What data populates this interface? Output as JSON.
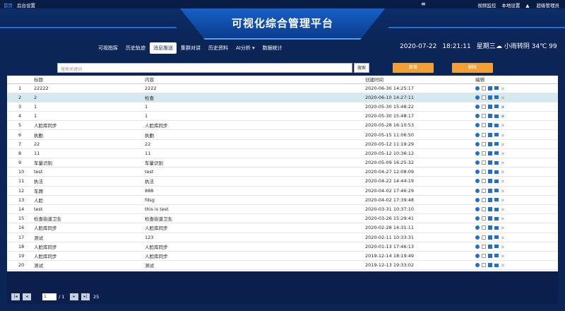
{
  "topbar": {
    "home": "首页",
    "settings": "后台设置",
    "menu": "≡",
    "video": "视频监控",
    "local": "本地设置",
    "user": "超级管理员"
  },
  "title": "可视化综合管理平台",
  "nav": [
    "可视指挥",
    "历史轨迹",
    "消息推送",
    "集群对讲",
    "历史资料",
    "AI分析 ▾",
    "数据统计"
  ],
  "date": "2020-07-22",
  "time": "18:21:11",
  "weekday": "星期三",
  "weather": "小雨转阴",
  "temp": "34℃ 99",
  "search": {
    "placeholder": "搜索关键词",
    "button": "搜索"
  },
  "add_btn": "新增",
  "delete_btn": "删除",
  "table": {
    "headers": [
      "",
      "标题",
      "内容",
      "创建时间",
      "编辑"
    ],
    "rows": [
      [
        "1",
        "22222",
        "2222",
        "2020-06-30 14:25:17"
      ],
      [
        "2",
        "2",
        "检查",
        "2020-06-10 14:27:11"
      ],
      [
        "3",
        "1",
        "1",
        "2020-05-30 15:48:22"
      ],
      [
        "4",
        "1",
        "1",
        "2020-05-30 15:48:17"
      ],
      [
        "5",
        "人脸库同步",
        "人脸库同步",
        "2020-05-28 16:10:53"
      ],
      [
        "6",
        "执勤",
        "执勤",
        "2020-05-15 11:06:50"
      ],
      [
        "7",
        "22",
        "22",
        "2020-05-12 11:19:29"
      ],
      [
        "8",
        "11",
        "11",
        "2020-05-12 10:36:12"
      ],
      [
        "9",
        "车量识别",
        "车量识别",
        "2020-05-09 16:25:32"
      ],
      [
        "10",
        "test",
        "test",
        "2020-04-27 12:08:09"
      ],
      [
        "11",
        "执法",
        "执法",
        "2020-04-22 14:44:19"
      ],
      [
        "12",
        "车牌",
        "888",
        "2020-04-02 17:46:29"
      ],
      [
        "13",
        "人脸",
        "fdsg",
        "2020-04-02 17:39:48"
      ],
      [
        "14",
        "test",
        "this is test",
        "2020-03-31 10:37:10"
      ],
      [
        "15",
        "检查街道卫生",
        "检查街道卫生",
        "2020-03-26 15:29:41"
      ],
      [
        "16",
        "人脸库同步",
        "人脸库同步",
        "2020-02-28 14:31:11"
      ],
      [
        "17",
        "测试",
        "123",
        "2020-02-11 10:33:31"
      ],
      [
        "18",
        "人脸库同步",
        "人脸库同步",
        "2020-01-13 17:46:13"
      ],
      [
        "19",
        "人脸库同步",
        "人脸库同步",
        "2019-12-14 18:19:49"
      ],
      [
        "20",
        "测试",
        "测试",
        "2019-12-13 19:33:02"
      ]
    ]
  },
  "pager": {
    "page": "1",
    "of": "/ 1",
    "total": "25"
  }
}
